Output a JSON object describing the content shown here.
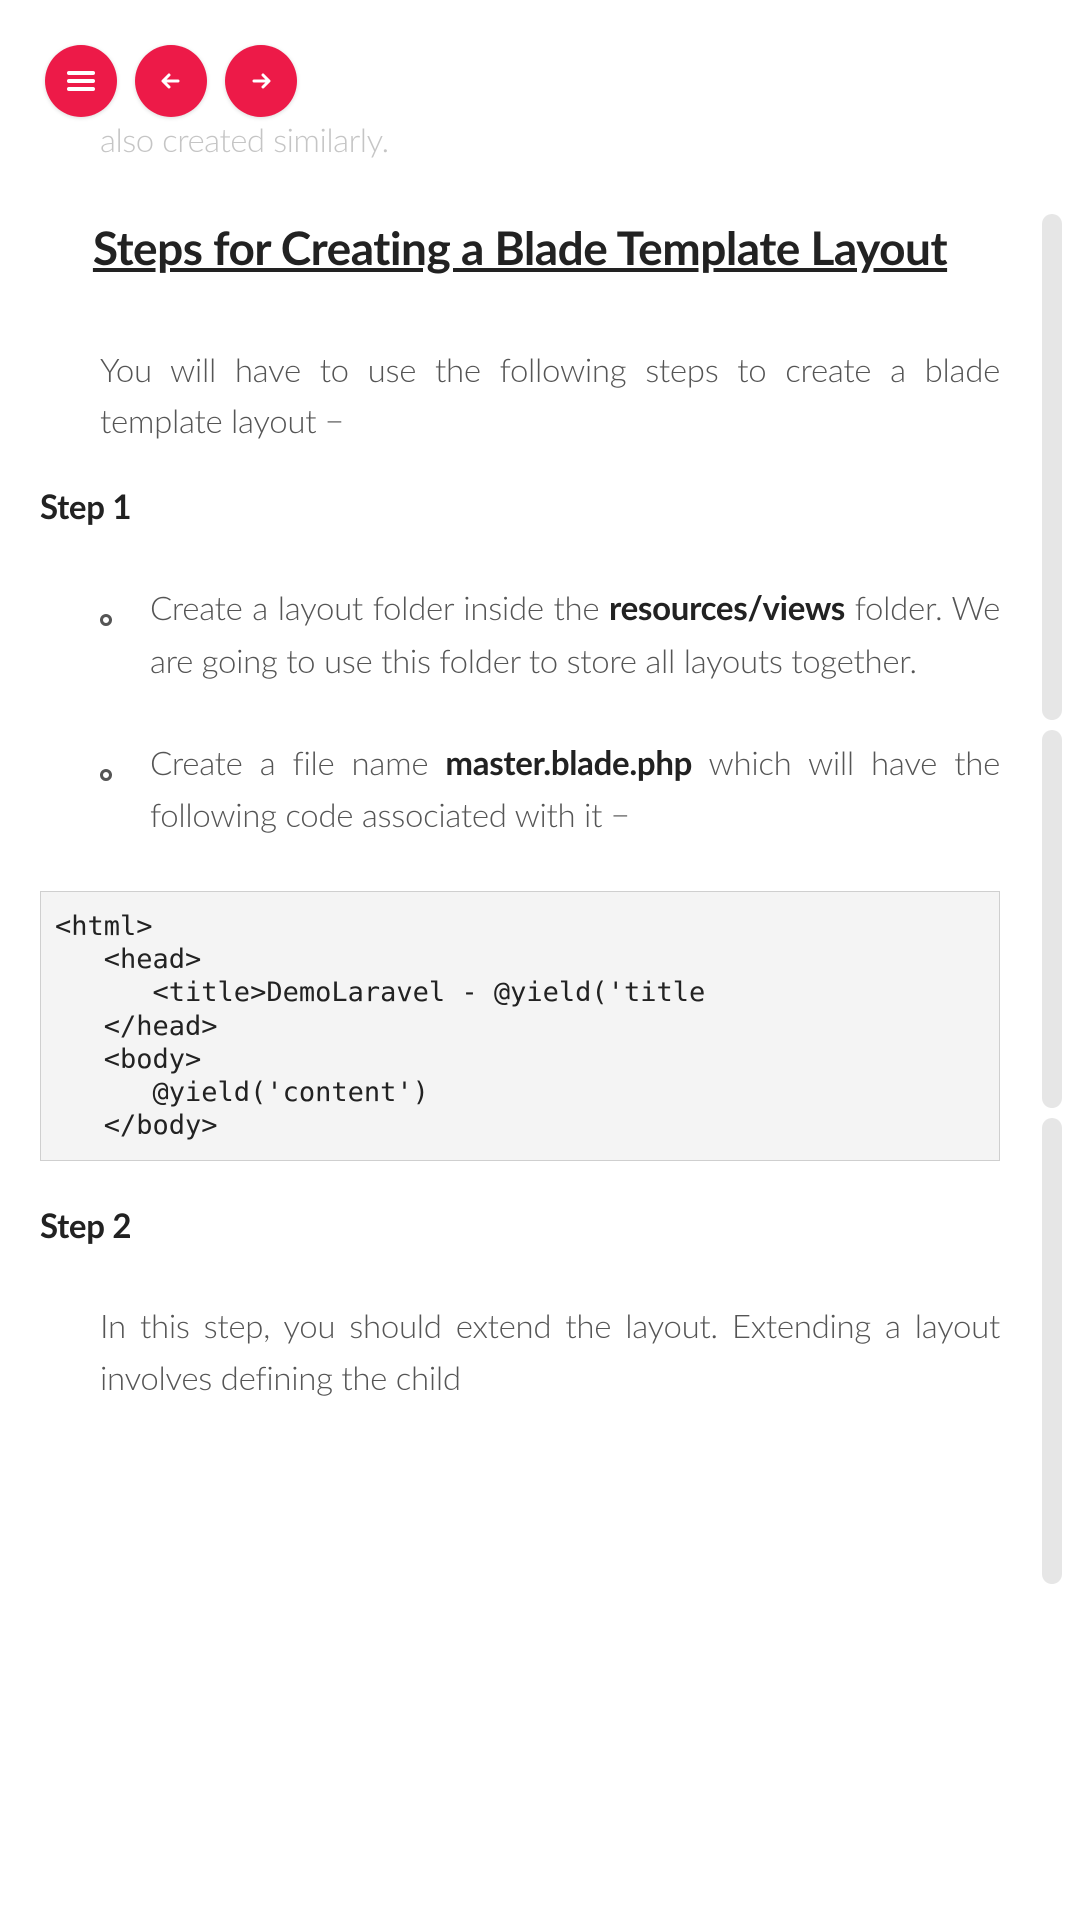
{
  "nav": {
    "menu_name": "menu-button",
    "back_name": "back-button",
    "fwd_name": "forward-button"
  },
  "partial_top": "also created similarly.",
  "heading": "Steps for Creating a Blade Template Layout",
  "intro": "You will have to use the following steps to create a blade template layout −",
  "step1_label": "Step 1",
  "bullet1": {
    "lead": "Create a layout folder inside the ",
    "bold": "resources/views",
    "tail": " folder. We are going to use this folder to store all layouts together."
  },
  "bullet2": {
    "lead": "Create a file name ",
    "bold": "master.blade.php",
    "tail": " which will have the following code associated with it −"
  },
  "code": "<html>\n   <head>\n      <title>DemoLaravel - @yield('title\n   </head>\n   <body>\n      @yield('content')\n   </body>",
  "step2_label": "Step 2",
  "step2_para": "In this step, you should extend the layout. Extending a layout involves defining the child"
}
